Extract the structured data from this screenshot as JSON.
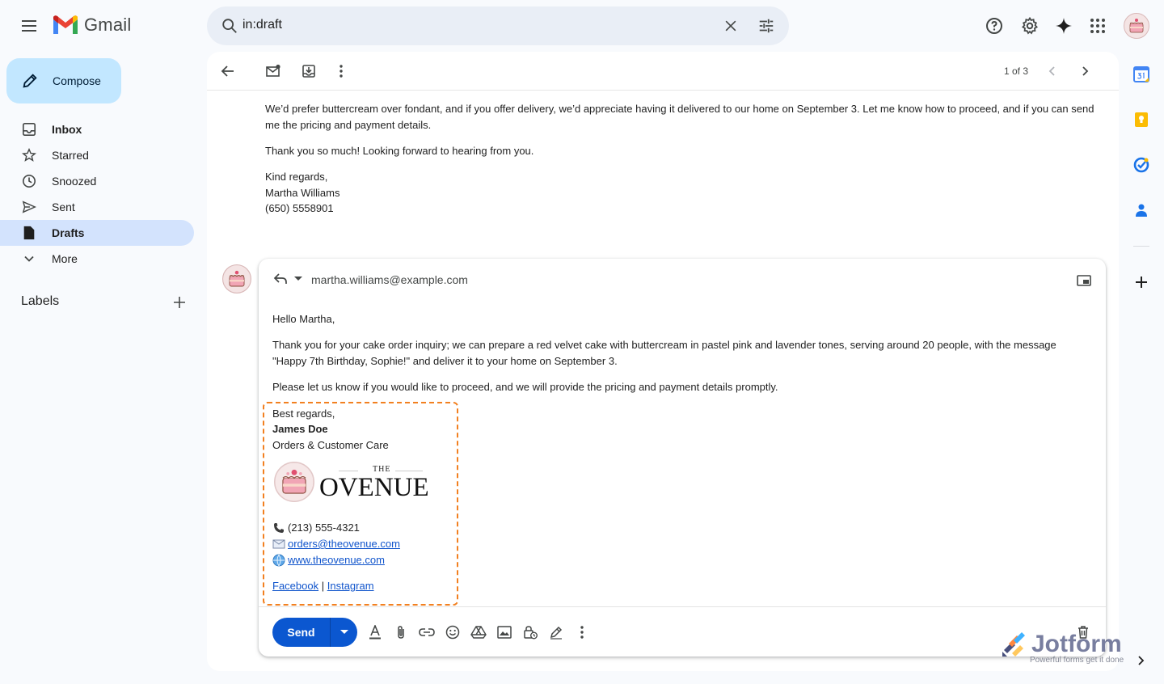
{
  "app": {
    "name": "Gmail"
  },
  "search": {
    "query": "in:draft"
  },
  "compose": {
    "label": "Compose"
  },
  "nav": {
    "items": [
      {
        "label": "Inbox",
        "icon": "inbox-icon"
      },
      {
        "label": "Starred",
        "icon": "star-icon"
      },
      {
        "label": "Snoozed",
        "icon": "clock-icon"
      },
      {
        "label": "Sent",
        "icon": "send-icon"
      },
      {
        "label": "Drafts",
        "icon": "draft-icon"
      },
      {
        "label": "More",
        "icon": "chevron-down-icon"
      }
    ],
    "labels_title": "Labels"
  },
  "toolbar": {
    "pager": "1 of 3"
  },
  "thread": {
    "paragraph1": "We’d prefer buttercream over fondant, and if you offer delivery, we’d appreciate having it delivered to our home on September 3. Let me know how to proceed, and if you can send me the pricing and payment details.",
    "paragraph2": "Thank you so much! Looking forward to hearing from you.",
    "closing": "Kind regards,",
    "name": "Martha Williams",
    "phone": "(650) 5558901"
  },
  "reply": {
    "to": "martha.williams@example.com",
    "greeting": "Hello Martha,",
    "paragraph1": "Thank you for your cake order inquiry; we can prepare a red velvet cake with buttercream in pastel pink and lavender tones, serving around 20 people, with the message \"Happy 7th Birthday, Sophie!\" and deliver it to your home on September 3.",
    "paragraph2": "Please let us know if you would like to proceed, and we will provide the pricing and payment details promptly.",
    "send_label": "Send"
  },
  "signature": {
    "closing": "Best regards,",
    "name": "James Doe",
    "title": "Orders & Customer Care",
    "logo_small": "THE",
    "logo_big": "OVENUE",
    "phone": "(213) 555-4321",
    "email": "orders@theovenue.com",
    "website": "www.theovenue.com",
    "facebook": "Facebook",
    "separator": "|",
    "instagram": "Instagram"
  },
  "watermark": {
    "brand": "Jotform",
    "tagline": "Powerful forms get it done"
  },
  "colors": {
    "accent": "#0b57d0",
    "compose_bg": "#c2e7ff",
    "active_nav": "#d3e3fd",
    "signature_border": "#f28020"
  }
}
